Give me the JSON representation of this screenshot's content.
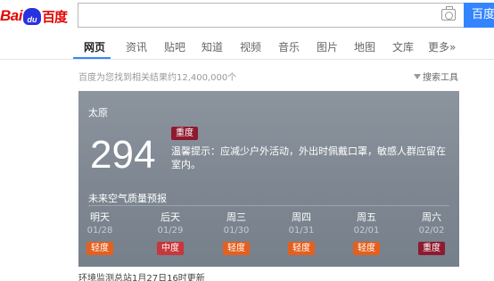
{
  "header": {
    "logo": "Baidu百度",
    "search_value": "",
    "search_button": "百度一下"
  },
  "nav": {
    "items": [
      "网页",
      "资讯",
      "贴吧",
      "知道",
      "视频",
      "音乐",
      "图片",
      "地图",
      "文库",
      "更多»"
    ],
    "active": "网页"
  },
  "results": {
    "count_text": "百度为您找到相关结果约12,400,000个",
    "tools_label": "搜索工具"
  },
  "air_quality": {
    "city": "太原",
    "aqi": "294",
    "level": "重度",
    "tip": "温馨提示：应减少户外活动，外出时佩戴口罩，敏感人群应留在室内。",
    "forecast_title": "未来空气质量预报",
    "forecast": [
      {
        "day": "明天",
        "date": "01/28",
        "level": "轻度",
        "color": "#e3601f"
      },
      {
        "day": "后天",
        "date": "01/29",
        "level": "中度",
        "color": "#c7373b"
      },
      {
        "day": "周三",
        "date": "01/30",
        "level": "轻度",
        "color": "#e3601f"
      },
      {
        "day": "周四",
        "date": "01/31",
        "level": "轻度",
        "color": "#e3601f"
      },
      {
        "day": "周五",
        "date": "02/01",
        "level": "轻度",
        "color": "#e3601f"
      },
      {
        "day": "周六",
        "date": "02/02",
        "level": "重度",
        "color": "#8e1a2f"
      }
    ],
    "update_text": "环境监测总站1月27日16时更新"
  },
  "colors": {
    "accent": "#3385ff",
    "brand_red": "#e10602",
    "card_bg": "#7e8791"
  }
}
